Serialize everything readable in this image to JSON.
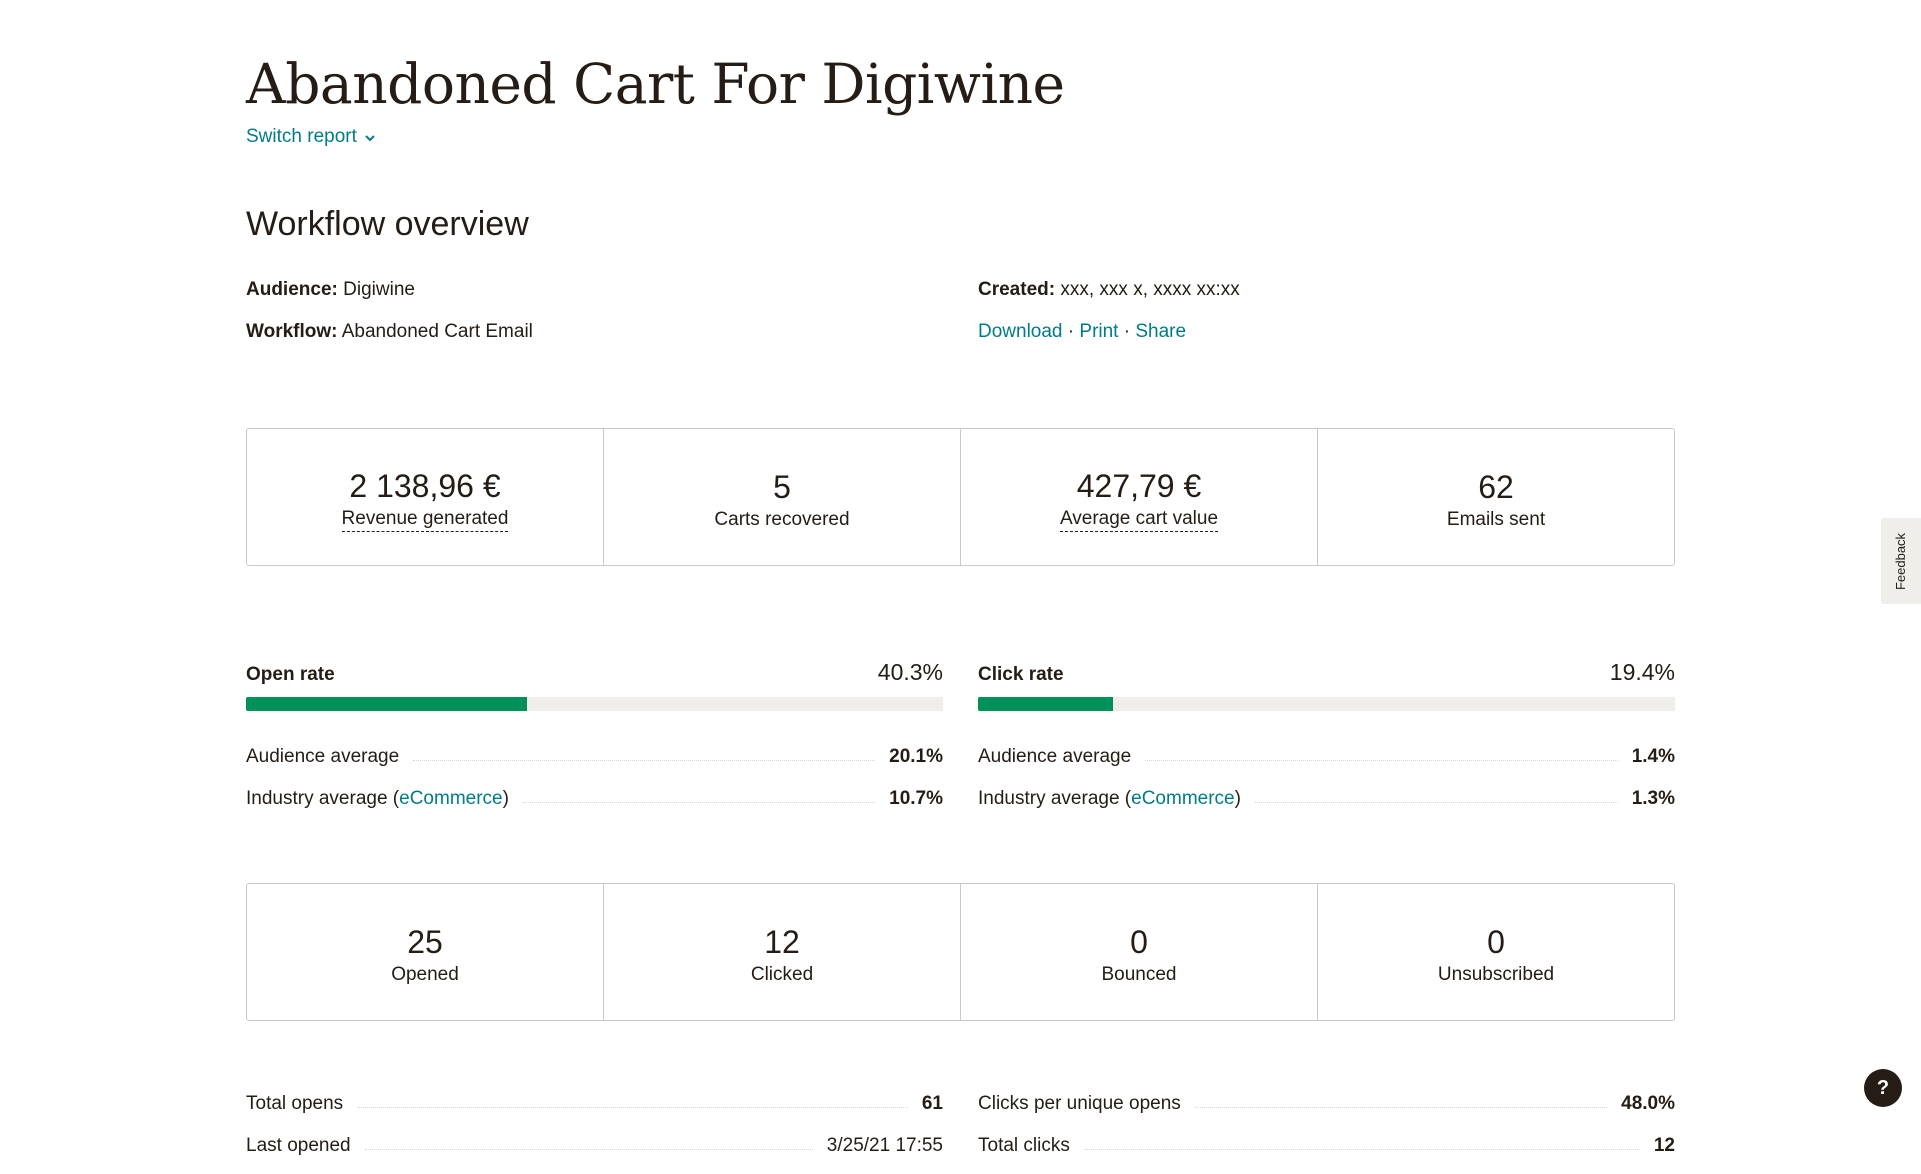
{
  "header": {
    "title": "Abandoned Cart For Digiwine",
    "switch_report": "Switch report"
  },
  "overview": {
    "title": "Workflow overview",
    "audience_label": "Audience:",
    "audience_value": "Digiwine",
    "workflow_label": "Workflow:",
    "workflow_value": "Abandoned Cart Email",
    "created_label": "Created:",
    "created_value": "xxx, xxx x, xxxx xx:xx",
    "actions": {
      "download": "Download",
      "print": "Print",
      "share": "Share",
      "separator": "·"
    }
  },
  "revenue_stats": [
    {
      "value": "2 138,96 €",
      "label": "Revenue generated"
    },
    {
      "value": "5",
      "label": "Carts recovered"
    },
    {
      "value": "427,79 €",
      "label": "Average cart value"
    },
    {
      "value": "62",
      "label": "Emails sent"
    }
  ],
  "open_rate": {
    "label": "Open rate",
    "value": "40.3%",
    "fill_percent": 40.3,
    "audience_label": "Audience average",
    "audience_value": "20.1%",
    "industry_label_prefix": "Industry average (",
    "industry_link": "eCommerce",
    "industry_label_suffix": ")",
    "industry_value": "10.7%"
  },
  "click_rate": {
    "label": "Click rate",
    "value": "19.4%",
    "fill_percent": 19.4,
    "audience_label": "Audience average",
    "audience_value": "1.4%",
    "industry_label_prefix": "Industry average (",
    "industry_link": "eCommerce",
    "industry_label_suffix": ")",
    "industry_value": "1.3%"
  },
  "engagement_stats": [
    {
      "value": "25",
      "label": "Opened"
    },
    {
      "value": "12",
      "label": "Clicked"
    },
    {
      "value": "0",
      "label": "Bounced"
    },
    {
      "value": "0",
      "label": "Unsubscribed"
    }
  ],
  "details_left": [
    {
      "label": "Total opens",
      "value": "61"
    },
    {
      "label": "Last opened",
      "value": "3/25/21 17:55"
    }
  ],
  "details_right": [
    {
      "label": "Clicks per unique opens",
      "value": "48.0%"
    },
    {
      "label": "Total clicks",
      "value": "12"
    }
  ],
  "feedback_tab": "Feedback",
  "help_button": "?",
  "colors": {
    "accent_link": "#007c89",
    "bar_fill": "#00905a",
    "bar_track": "#efeeea",
    "text": "#241c15"
  }
}
